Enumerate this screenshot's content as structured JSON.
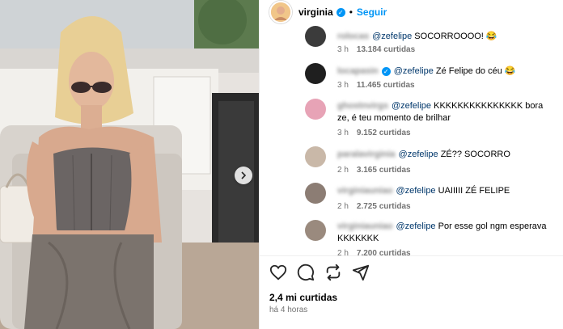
{
  "post": {
    "username": "virginia",
    "separator": "•",
    "follow_label": "Seguir",
    "likes_total": "2,4 mi curtidas",
    "time_ago": "há 4 horas"
  },
  "comments": [
    {
      "user": "rolocas",
      "mention": "@zefelipe",
      "text": "SOCORROOOO! 😂",
      "time": "3 h",
      "likes": "13.184 curtidas",
      "avatar_color": "#3b3b3b"
    },
    {
      "user": "locapasin",
      "mention": "@zefelipe",
      "text": "Zé Felipe do céu 😂",
      "time": "3 h",
      "likes": "11.465 curtidas",
      "avatar_color": "#1f1f1f"
    },
    {
      "user": "ghostnvirgs",
      "mention": "@zefelipe",
      "text": "KKKKKKKKKKKKKKK bora ze, é teu momento de brilhar",
      "time": "3 h",
      "likes": "9.152 curtidas",
      "avatar_color": "#e7a3b6"
    },
    {
      "user": "paralavirginia",
      "mention": "@zefelipe",
      "text": "ZÉ?? SOCORRO",
      "time": "2 h",
      "likes": "3.165 curtidas",
      "avatar_color": "#c9b8a8"
    },
    {
      "user": "virginiauniao",
      "mention": "@zefelipe",
      "text": "UAIIIII ZÉ FELIPE",
      "time": "2 h",
      "likes": "2.725 curtidas",
      "avatar_color": "#8c7d74"
    },
    {
      "user": "virginiauniao",
      "mention": "@zefelipe",
      "text": "Por esse gol ngm esperava KKKKKKK",
      "time": "2 h",
      "likes": "7.200 curtidas",
      "avatar_color": "#9a8a7e"
    }
  ],
  "colors": {
    "accent": "#0095f6",
    "mention": "#00376b",
    "meta": "#737373"
  },
  "icons": [
    "heart-icon",
    "comment-icon",
    "share-icon",
    "send-icon",
    "chevron-right-icon",
    "verified-icon"
  ]
}
